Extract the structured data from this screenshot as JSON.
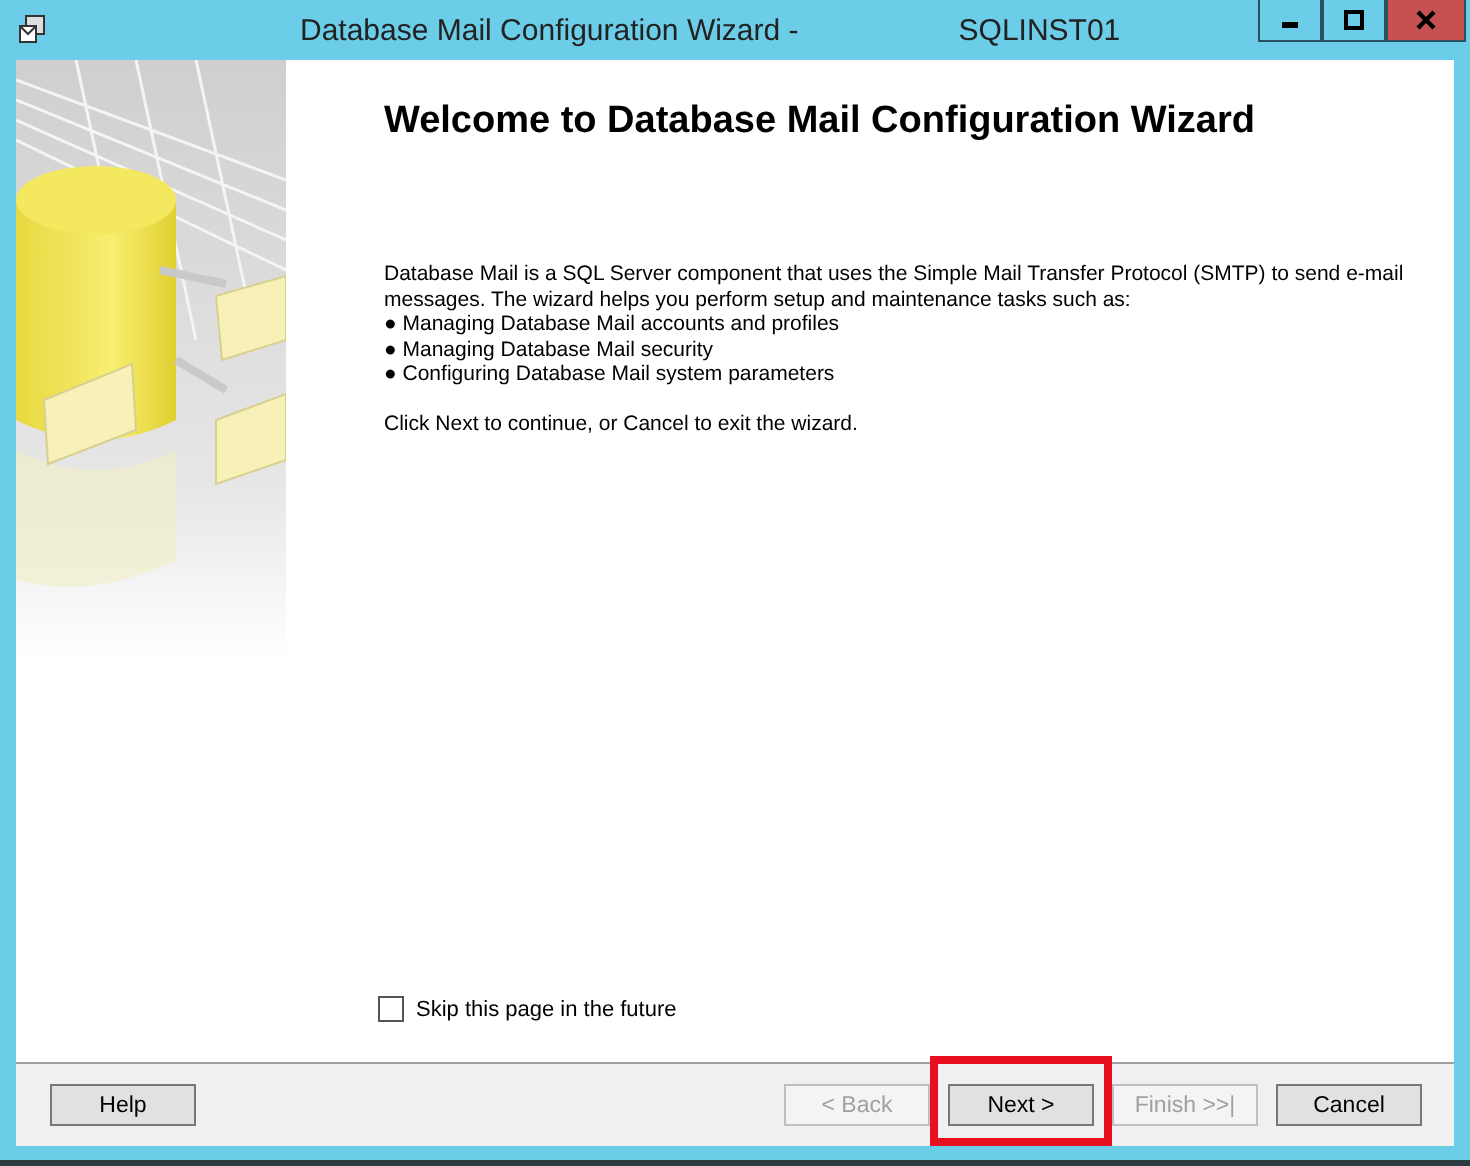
{
  "window": {
    "title": "Database Mail Configuration Wizard -",
    "instance": "SQLINST01"
  },
  "page": {
    "heading": "Welcome to Database Mail Configuration Wizard",
    "intro": [
      "Database Mail is a SQL Server component that uses the Simple Mail Transfer Protocol (SMTP) to send e-mail messages. The wizard helps you perform setup and maintenance tasks such as:",
      "● Managing Database Mail accounts and profiles",
      "● Managing Database Mail security",
      "● Configuring Database Mail system parameters"
    ],
    "closing": "Click Next to continue, or Cancel to exit the wizard.",
    "skip_checkbox": {
      "label": "Skip this page in the future",
      "checked": false
    }
  },
  "help_button": {
    "label": "Help",
    "disabled": false,
    "highlighted": false
  },
  "nav_buttons": [
    {
      "label": "< Back",
      "disabled": true,
      "highlighted": false
    },
    {
      "label": "Next >",
      "disabled": false,
      "highlighted": true
    },
    {
      "label": "Finish >>|",
      "disabled": true,
      "highlighted": false
    },
    {
      "label": "Cancel",
      "disabled": false,
      "highlighted": false
    }
  ]
}
